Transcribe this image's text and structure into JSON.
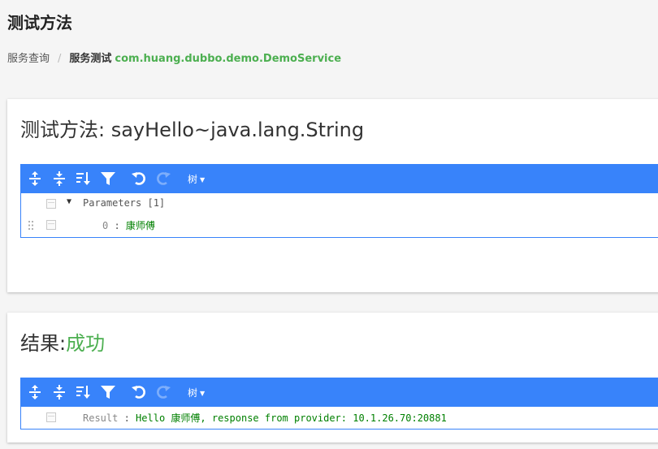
{
  "page": {
    "title": "测试方法"
  },
  "breadcrumb": {
    "parent": "服务查询",
    "separator": "/",
    "current": "服务测试",
    "service": "com.huang.dubbo.demo.DemoService"
  },
  "method_card": {
    "title": "测试方法: sayHello~java.lang.String",
    "editor": {
      "mode_label": "树",
      "tree": {
        "root_key": "Parameters",
        "root_count": "[1]",
        "items": [
          {
            "key": "0",
            "value": "康师傅"
          }
        ]
      }
    }
  },
  "result_card": {
    "title_prefix": "结果:",
    "status": "成功",
    "editor": {
      "mode_label": "树",
      "result_key": "Result",
      "result_value": "Hello 康师傅, response from provider: 10.1.26.70:20881"
    }
  },
  "colors": {
    "toolbar": "#3883fa",
    "success": "#4caf50",
    "string_value": "#008000"
  },
  "icons": [
    "expand-all-icon",
    "collapse-all-icon",
    "sort-icon",
    "filter-icon",
    "undo-icon",
    "redo-icon",
    "drag-handle-icon"
  ]
}
